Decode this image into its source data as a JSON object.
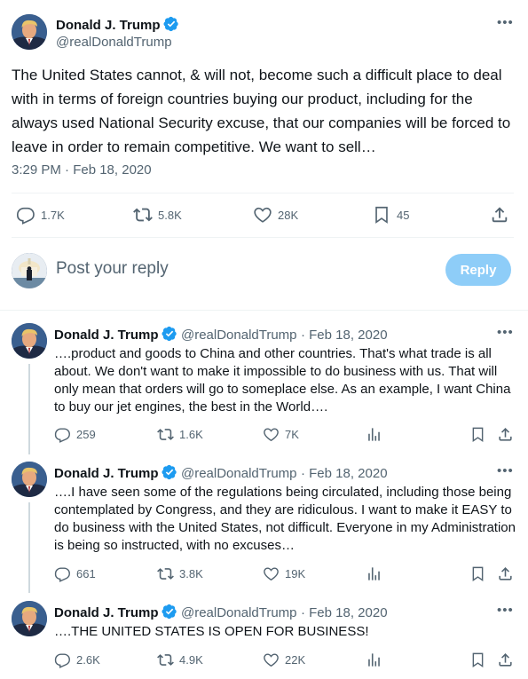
{
  "main_tweet": {
    "author_name": "Donald J. Trump",
    "author_handle": "@realDonaldTrump",
    "text": "The United States cannot, & will not, become such a difficult place to deal with in terms of foreign countries buying our product, including for the always used National Security excuse, that our companies will be forced to leave in order to remain competitive. We want to sell…",
    "timestamp": "3:29 PM · Feb 18, 2020",
    "replies": "1.7K",
    "retweets": "5.8K",
    "likes": "28K",
    "bookmarks": "45"
  },
  "reply_box": {
    "placeholder": "Post your reply",
    "button_label": "Reply"
  },
  "thread": [
    {
      "author_name": "Donald J. Trump",
      "author_handle": "@realDonaldTrump",
      "date": "· Feb 18, 2020",
      "text": "….product and goods to China and other countries. That's what trade is all about. We don't want to make it impossible to do business with us. That will only mean that orders will go to someplace else. As an example, I want China to buy our jet engines, the best in the World….",
      "replies": "259",
      "retweets": "1.6K",
      "likes": "7K"
    },
    {
      "author_name": "Donald J. Trump",
      "author_handle": "@realDonaldTrump",
      "date": "· Feb 18, 2020",
      "text": "….I have seen some of the regulations being circulated, including those being contemplated by Congress, and they are ridiculous. I want to make it EASY to do business with the United States, not difficult. Everyone in my Administration is being so instructed, with no excuses…",
      "replies": "661",
      "retweets": "3.8K",
      "likes": "19K"
    },
    {
      "author_name": "Donald J. Trump",
      "author_handle": "@realDonaldTrump",
      "date": "· Feb 18, 2020",
      "text": "….THE UNITED STATES IS OPEN FOR BUSINESS!",
      "replies": "2.6K",
      "retweets": "4.9K",
      "likes": "22K"
    }
  ],
  "icons": {
    "verified": "verified-badge-icon",
    "more": "more-icon",
    "reply": "reply-icon",
    "retweet": "retweet-icon",
    "like": "like-icon",
    "bookmark": "bookmark-icon",
    "share": "share-icon",
    "views": "views-icon"
  },
  "colors": {
    "text": "#0f1419",
    "secondary": "#536471",
    "verified": "#1d9bf0",
    "reply_button": "#8ecdf8"
  }
}
